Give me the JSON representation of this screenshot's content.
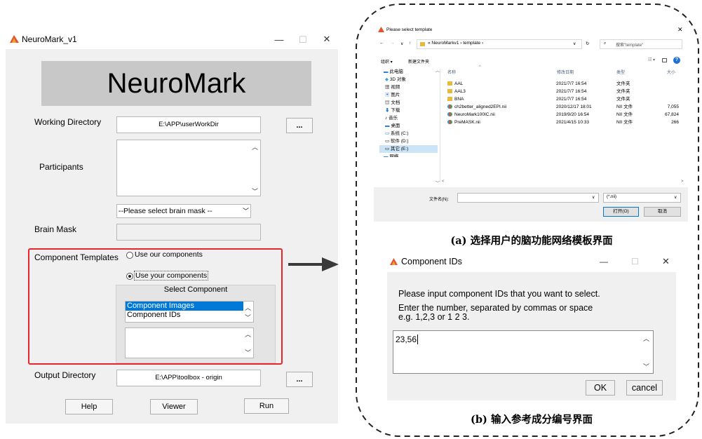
{
  "main_window": {
    "title": "NeuroMark_v1",
    "controls": {
      "minimize": "—",
      "maximize": "☐",
      "close": "✕"
    },
    "banner": "NeuroMark",
    "working_directory": {
      "label": "Working Directory",
      "value": "E:\\APP\\userWorkDir",
      "browse": "..."
    },
    "participants": {
      "label": "Participants"
    },
    "brain_mask": {
      "select": "--Please select brain mask --",
      "label": "Brain Mask"
    },
    "component_templates": {
      "label": "Component Templates",
      "option_ours": "Use our components",
      "option_yours": "Use your components",
      "selected": "Use your components",
      "panel_title": "Select Component",
      "list": [
        "Component Images",
        "Component IDs"
      ],
      "list_selected": "Component Images"
    },
    "output_directory": {
      "label": "Output Directory",
      "value": "E:\\APP\\toolbox - origin",
      "browse": "..."
    },
    "buttons": {
      "help": "Help",
      "viewer": "Viewer",
      "run": "Run"
    }
  },
  "file_dialog": {
    "title": "Please select template",
    "close": "✕",
    "nav": {
      "back": "←",
      "forward": "→",
      "down": "∨",
      "up": "↑"
    },
    "breadcrumb": "« NeuroMarkv1 › template ›",
    "refresh": "↻",
    "search_placeholder": "搜索\"template\"",
    "toolbar": {
      "organize": "组织 ▾",
      "new_folder": "新建文件夹"
    },
    "sidebar": [
      "此电脑",
      "3D 对象",
      "视频",
      "图片",
      "文档",
      "下载",
      "音乐",
      "桌面",
      "系统 (C:)",
      "软件 (D:)",
      "其它 (E:)",
      "网络"
    ],
    "columns": {
      "name": "名称",
      "date": "修改日期",
      "type": "类型",
      "size": "大小"
    },
    "files": [
      {
        "name": "AAL",
        "date": "2021/7/7 16:54",
        "type": "文件夹",
        "size": "",
        "kind": "folder"
      },
      {
        "name": "AAL3",
        "date": "2021/7/7 16:54",
        "type": "文件夹",
        "size": "",
        "kind": "folder"
      },
      {
        "name": "BNA",
        "date": "2021/7/7 16:54",
        "type": "文件夹",
        "size": "",
        "kind": "folder"
      },
      {
        "name": "ch2better_aligned2EPI.nii",
        "date": "2020/12/17 18:01",
        "type": "NII 文件",
        "size": "7,055",
        "kind": "nii"
      },
      {
        "name": "NeuroMark100IC.nii",
        "date": "2019/9/20 16:54",
        "type": "NII 文件",
        "size": "67,824",
        "kind": "nii"
      },
      {
        "name": "PreMASK.nii",
        "date": "2021/4/15 10:33",
        "type": "NII 文件",
        "size": "266",
        "kind": "nii"
      }
    ],
    "filename_label": "文件名(N):",
    "filter": "(*.nii)",
    "open": "打开(O)",
    "cancel": "取消"
  },
  "caption_a": "(a) 选择用户的脑功能网络模板界面",
  "ids_dialog": {
    "title": "Component IDs",
    "controls": {
      "minimize": "—",
      "maximize": "☐",
      "close": "✕"
    },
    "prompt": "Please input component IDs that you want to select.",
    "hint_line1": "Enter the number, separated by commas or space",
    "hint_line2": "e.g. 1,2,3 or 1 2 3.",
    "input_value": "23,56",
    "ok": "OK",
    "cancel": "cancel"
  },
  "caption_b": "(b) 输入参考成分编号界面",
  "colors": {
    "highlight": "#0078d7",
    "red_frame": "#e8262a",
    "dialog_bg": "#f0f0f0"
  }
}
